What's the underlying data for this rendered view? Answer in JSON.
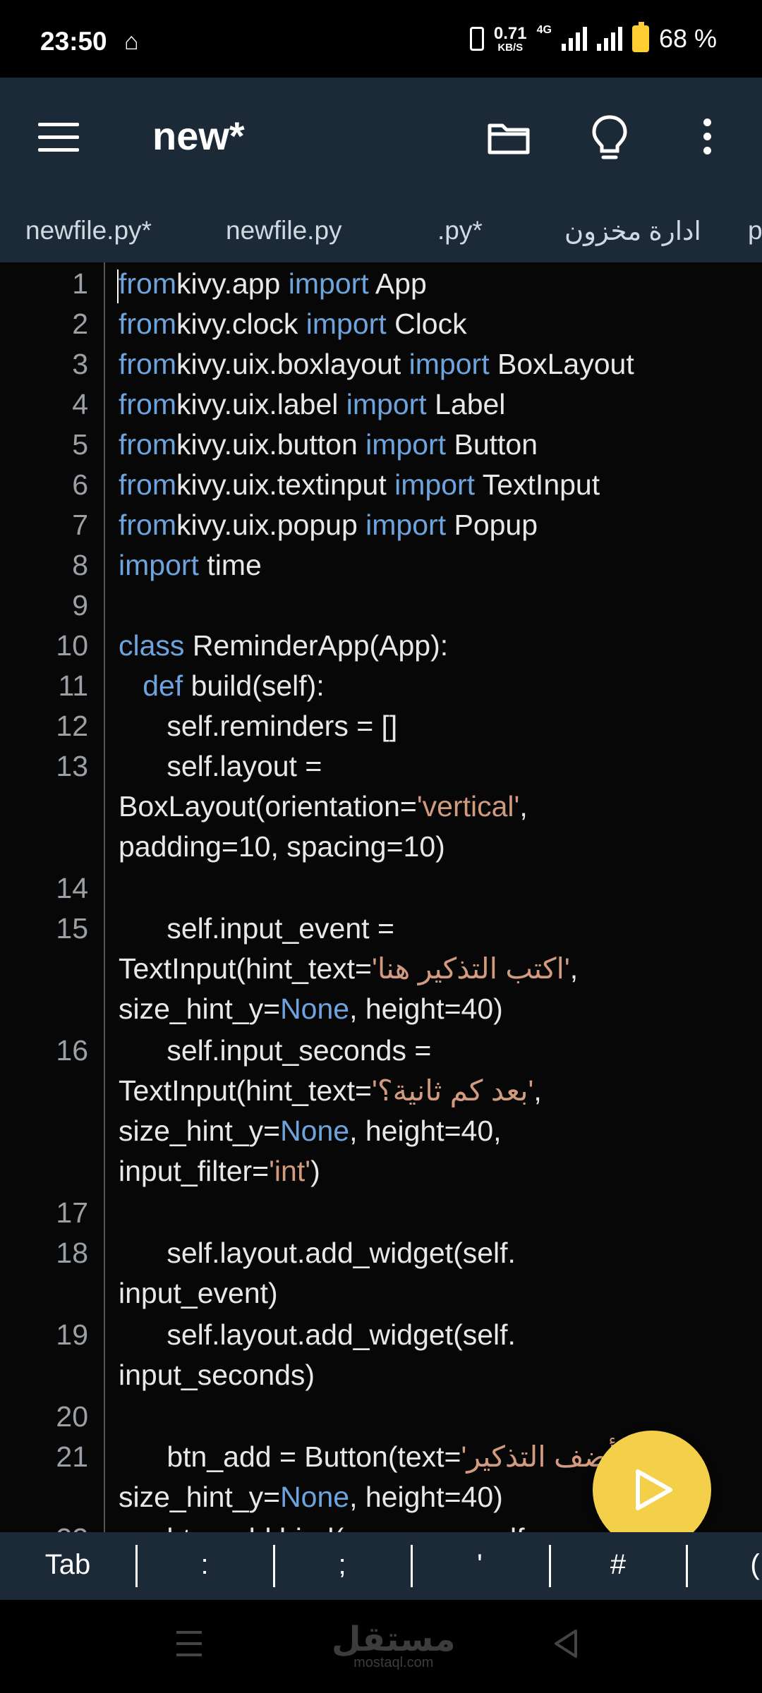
{
  "status_bar": {
    "time": "23:50",
    "speed_value": "0.71",
    "speed_unit": "KB/S",
    "network": "4G",
    "battery": "68 %"
  },
  "app_bar": {
    "title": "new*",
    "icons": [
      "menu-icon",
      "folder-icon",
      "lightbulb-icon",
      "more-vert-icon"
    ]
  },
  "tabs": [
    "newfile.py*",
    "newfile.py",
    ".py*",
    "ادارة مخزون",
    "p"
  ],
  "editor": {
    "lines": [
      {
        "n": "1",
        "segs": [
          [
            "kw",
            "from"
          ],
          [
            "",
            "kivy.app "
          ],
          [
            "kw",
            "import"
          ],
          [
            "",
            " App"
          ]
        ]
      },
      {
        "n": "2",
        "segs": [
          [
            "kw",
            "from"
          ],
          [
            "",
            "kivy.clock "
          ],
          [
            "kw",
            "import"
          ],
          [
            "",
            " Clock"
          ]
        ]
      },
      {
        "n": "3",
        "segs": [
          [
            "kw",
            "from"
          ],
          [
            "",
            "kivy.uix.boxlayout "
          ],
          [
            "kw",
            "import"
          ],
          [
            "",
            " BoxLayout"
          ]
        ]
      },
      {
        "n": "4",
        "segs": [
          [
            "kw",
            "from"
          ],
          [
            "",
            "kivy.uix.label "
          ],
          [
            "kw",
            "import"
          ],
          [
            "",
            " Label"
          ]
        ]
      },
      {
        "n": "5",
        "segs": [
          [
            "kw",
            "from"
          ],
          [
            "",
            "kivy.uix.button "
          ],
          [
            "kw",
            "import"
          ],
          [
            "",
            " Button"
          ]
        ]
      },
      {
        "n": "6",
        "segs": [
          [
            "kw",
            "from"
          ],
          [
            "",
            "kivy.uix.textinput "
          ],
          [
            "kw",
            "import"
          ],
          [
            "",
            " TextInput"
          ]
        ]
      },
      {
        "n": "7",
        "segs": [
          [
            "kw",
            "from"
          ],
          [
            "",
            "kivy.uix.popup "
          ],
          [
            "kw",
            "import"
          ],
          [
            "",
            " Popup"
          ]
        ]
      },
      {
        "n": "8",
        "segs": [
          [
            "kw",
            "import"
          ],
          [
            "",
            " time"
          ]
        ]
      },
      {
        "n": "9",
        "segs": []
      },
      {
        "n": "10",
        "segs": [
          [
            "kw",
            "class"
          ],
          [
            "",
            " ReminderApp(App):"
          ]
        ]
      },
      {
        "n": "11",
        "segs": [
          [
            "",
            "   "
          ],
          [
            "kw",
            "def"
          ],
          [
            "",
            " build(self):"
          ]
        ]
      },
      {
        "n": "12",
        "segs": [
          [
            "",
            "      self.reminders = []"
          ]
        ]
      },
      {
        "n": "13",
        "segs": [
          [
            "",
            "      self.layout =\nBoxLayout(orientation="
          ],
          [
            "str",
            "'vertical'"
          ],
          [
            "",
            ",\npadding=10, spacing=10)"
          ]
        ]
      },
      {
        "n": "14",
        "segs": []
      },
      {
        "n": "15",
        "segs": [
          [
            "",
            "      self.input_event =\nTextInput(hint_text="
          ],
          [
            "str",
            "'اكتب التذكير هنا'"
          ],
          [
            "",
            ",\nsize_hint_y="
          ],
          [
            "kw",
            "None"
          ],
          [
            "",
            ", height=40)"
          ]
        ]
      },
      {
        "n": "16",
        "segs": [
          [
            "",
            "      self.input_seconds =\nTextInput(hint_text="
          ],
          [
            "str",
            "'بعد كم ثانية؟'"
          ],
          [
            "",
            ",\nsize_hint_y="
          ],
          [
            "kw",
            "None"
          ],
          [
            "",
            ", height=40,\ninput_filter="
          ],
          [
            "str",
            "'int'"
          ],
          [
            "",
            ")"
          ]
        ]
      },
      {
        "n": "17",
        "segs": []
      },
      {
        "n": "18",
        "segs": [
          [
            "",
            "      self.layout.add_widget(self.\ninput_event)"
          ]
        ]
      },
      {
        "n": "19",
        "segs": [
          [
            "",
            "      self.layout.add_widget(self.\ninput_seconds)"
          ]
        ]
      },
      {
        "n": "20",
        "segs": []
      },
      {
        "n": "21",
        "segs": [
          [
            "",
            "      btn_add = Button(text="
          ],
          [
            "str",
            "'أضف التذكير'"
          ],
          [
            "",
            ",\nsize_hint_y="
          ],
          [
            "kw",
            "None"
          ],
          [
            "",
            ", height=40)"
          ]
        ]
      },
      {
        "n": "22",
        "segs": [
          [
            "",
            "      btn_add.bind(on_press=self."
          ]
        ]
      }
    ]
  },
  "run_button": {
    "icon": "play-icon"
  },
  "symbol_bar": {
    "keys": [
      "Tab",
      ":",
      ";",
      "'",
      "#",
      "("
    ]
  },
  "nav_bar": {
    "watermark_ar": "مستقل",
    "watermark_en": "mostaql.com",
    "icons": [
      "recents-icon",
      "home-icon",
      "back-icon"
    ]
  },
  "colors": {
    "app_bar": "#1c2a38",
    "keyword": "#6ea4dd",
    "string": "#d29b7f",
    "fab": "#f4cf4a"
  }
}
